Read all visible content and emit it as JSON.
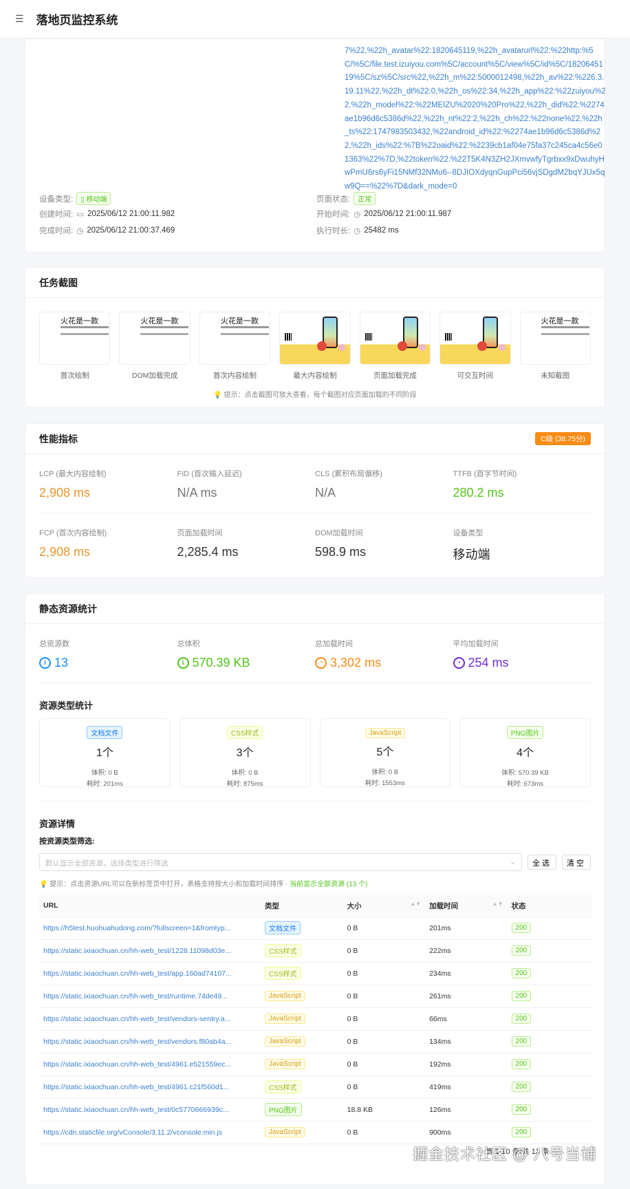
{
  "header": {
    "title": "落地页监控系统",
    "menu_icon": "menu-fold-icon"
  },
  "info": {
    "url_tail": "7%22,%22h_avatar%22:1820645119,%22h_avatarurl%22:%22http:%5C/%5C/file.test.izuiyou.com%5C/account%5C/view%5C/id%5C/1820645119%5C/sz%5C/src%22,%22h_m%22:5000012498,%22h_av%22:%226.3.19.11%22,%22h_dt%22:0,%22h_os%22:34,%22h_app%22:%22zuiyou%22,%22h_model%22:%22MEIZU%2020%20Pro%22,%22h_did%22:%2274ae1b96d6c5386d%22,%22h_nt%22:2,%22h_ch%22:%22none%22,%22h_ts%22:1747983503432,%22android_id%22:%2274ae1b96d6c5386d%22,%22h_ids%22:%7B%22oaid%22:%2239cb1af04e75fa37c245ca4c56e01363%22%7D,%22token%22:%22T5K4N3ZH2JXmvwfyTgrbxx9xDwuhyHwPmU6rs6yFi15NMf32NMu6--8DJIOXdyqnGupPci56vjSDgdM2bqYJUx5qw9Q==%22%7D&dark_mode=0",
    "device_label": "设备类型:",
    "device_value": "移动端",
    "status_label": "页面状态:",
    "status_value": "正常",
    "created_label": "创建时间:",
    "created_value": "2025/06/12 21:00:11.982",
    "start_label": "开始时间:",
    "start_value": "2025/06/12 21:00:11.987",
    "done_label": "完成时间:",
    "done_value": "2025/06/12 21:00:37.469",
    "duration_label": "执行时长:",
    "duration_value": "25482  ms"
  },
  "screenshots": {
    "title": "任务截图",
    "items": [
      "首次绘制",
      "DOM加载完成",
      "首次内容绘制",
      "最大内容绘制",
      "页面加载完成",
      "可交互时间",
      "未知截图"
    ],
    "thumb_text": "火花是一款",
    "hint": "提示：点击截图可放大查看，每个截图对应页面加载的不同阶段"
  },
  "performance": {
    "title": "性能指标",
    "grade": "C级 (38.75分)",
    "metrics": [
      {
        "label": "LCP (最大内容绘制)",
        "value": "2,908 ms",
        "color": "#e8962e"
      },
      {
        "label": "FID (首次输入延迟)",
        "value": "N/A ms",
        "color": "#777777"
      },
      {
        "label": "CLS (累积布局偏移)",
        "value": "N/A",
        "color": "#777777"
      },
      {
        "label": "TTFB (首字节时间)",
        "value": "280.2 ms",
        "color": "#52c41a"
      },
      {
        "label": "FCP (首次内容绘制)",
        "value": "2,908 ms",
        "color": "#e8962e"
      },
      {
        "label": "页面加载时间",
        "value": "2,285.4 ms",
        "color": "#333333"
      },
      {
        "label": "DOM加载时间",
        "value": "598.9 ms",
        "color": "#333333"
      },
      {
        "label": "设备类型",
        "value": "移动端",
        "color": "#222222"
      }
    ]
  },
  "static": {
    "title": "静态资源统计",
    "stats": [
      {
        "label": "总资源数",
        "value": "13",
        "color": "#1890ff",
        "icon": "info-icon"
      },
      {
        "label": "总体积",
        "value": "570.39 KB",
        "color": "#52c41a",
        "icon": "info-icon"
      },
      {
        "label": "总加载时间",
        "value": "3,302 ms",
        "color": "#fa8c16",
        "icon": "clock-icon"
      },
      {
        "label": "平均加载时间",
        "value": "254 ms",
        "color": "#722ed1",
        "icon": "clock-icon"
      }
    ],
    "types_title": "资源类型统计",
    "types": [
      {
        "tag": "文档文件",
        "cls": "blue",
        "count": "1个",
        "size": "体积: 0 B",
        "time": "耗时: 201ms"
      },
      {
        "tag": "CSS样式",
        "cls": "lime",
        "count": "3个",
        "size": "体积: 0 B",
        "time": "耗时: 875ms"
      },
      {
        "tag": "JavaScript",
        "cls": "gold",
        "count": "5个",
        "size": "体积: 0 B",
        "time": "耗时: 1553ms"
      },
      {
        "tag": "PNG图片",
        "cls": "green",
        "count": "4个",
        "size": "体积: 570.39 KB",
        "time": "耗时: 673ms"
      }
    ],
    "details_title": "资源详情",
    "filter_label": "按资源类型筛选:",
    "filter_placeholder": "默认显示全部资源，选择类型进行筛选",
    "select_all": "全选",
    "clear": "清空",
    "hint": "提示：点击资源URL可以在新标签页中打开，表格支持按大小和加载时间排序 ·",
    "hint_current": "当前显示全部资源 (13 个)",
    "columns": [
      "URL",
      "类型",
      "大小",
      "加载时间",
      "状态"
    ],
    "rows": [
      {
        "url": "https://h5test.huohuahudong.com/?fullscreen=1&fromtyp...",
        "type": "文档文件",
        "cls": "blue",
        "size": "0 B",
        "time": "201ms",
        "status": "200"
      },
      {
        "url": "https://static.ixiaochuan.cn/hh-web_test/1228.11098d03e...",
        "type": "CSS样式",
        "cls": "lime",
        "size": "0 B",
        "time": "222ms",
        "status": "200"
      },
      {
        "url": "https://static.ixiaochuan.cn/hh-web_test/app.160ad74107...",
        "type": "CSS样式",
        "cls": "lime",
        "size": "0 B",
        "time": "234ms",
        "status": "200"
      },
      {
        "url": "https://static.ixiaochuan.cn/hh-web_test/runtime.74de49...",
        "type": "JavaScript",
        "cls": "gold",
        "size": "0 B",
        "time": "261ms",
        "status": "200"
      },
      {
        "url": "https://static.ixiaochuan.cn/hh-web_test/vendors-sentry.a...",
        "type": "JavaScript",
        "cls": "gold",
        "size": "0 B",
        "time": "66ms",
        "status": "200"
      },
      {
        "url": "https://static.ixiaochuan.cn/hh-web_test/vendors.f80ab4a...",
        "type": "JavaScript",
        "cls": "gold",
        "size": "0 B",
        "time": "134ms",
        "status": "200"
      },
      {
        "url": "https://static.ixiaochuan.cn/hh-web_test/4961.e521559ec...",
        "type": "JavaScript",
        "cls": "gold",
        "size": "0 B",
        "time": "192ms",
        "status": "200"
      },
      {
        "url": "https://static.ixiaochuan.cn/hh-web_test/4961.c21f560d1...",
        "type": "CSS样式",
        "cls": "lime",
        "size": "0 B",
        "time": "419ms",
        "status": "200"
      },
      {
        "url": "https://static.ixiaochuan.cn/hh-web_test/0c5770666939c...",
        "type": "PNG图片",
        "cls": "green",
        "size": "18.8 KB",
        "time": "126ms",
        "status": "200"
      },
      {
        "url": "https://cdn.staticfile.org/vConsole/3.11.2/vconsole.min.js",
        "type": "JavaScript",
        "cls": "gold",
        "size": "0 B",
        "time": "900ms",
        "status": "200"
      }
    ],
    "pagination": "第 1-10 条/共 13 条"
  },
  "watermark": "掘金技术社区 @ 八号当铺"
}
